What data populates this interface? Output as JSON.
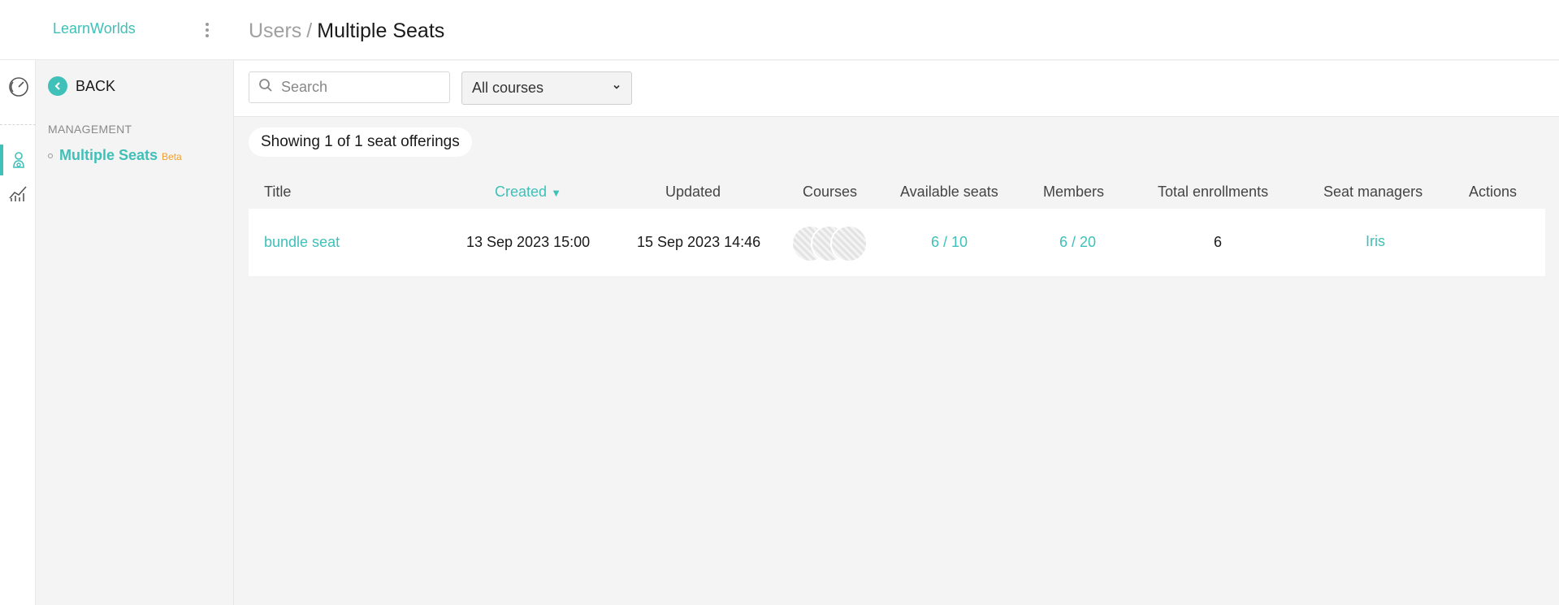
{
  "brand": {
    "name": "LearnWorlds"
  },
  "sidebar": {
    "back_label": "BACK",
    "section_heading": "MANAGEMENT",
    "items": [
      {
        "label": "Multiple Seats",
        "badge": "Beta",
        "active": true
      }
    ]
  },
  "rail": {
    "icons": [
      "gauge-icon",
      "user-seat-icon",
      "analytics-chart-icon"
    ],
    "active_color": "#3fc0b8"
  },
  "header": {
    "breadcrumb_parent": "Users",
    "breadcrumb_separator": "/",
    "breadcrumb_current": "Multiple Seats"
  },
  "toolbar": {
    "search_placeholder": "Search",
    "course_filter_value": "All courses"
  },
  "main": {
    "count_text": "Showing 1 of 1 seat offerings",
    "columns": [
      "Title",
      "Created",
      "Updated",
      "Courses",
      "Available seats",
      "Members",
      "Total enrollments",
      "Seat managers",
      "Actions"
    ],
    "sorted_column": "Created",
    "sort_indicator": "▼",
    "rows": [
      {
        "title": "bundle seat",
        "created": "13 Sep 2023 15:00",
        "updated": "15 Sep 2023 14:46",
        "course_count_thumbs": 3,
        "available_seats": "6 / 10",
        "members": "6 / 20",
        "total_enrollments": "6",
        "seat_managers": "Iris",
        "actions": ""
      }
    ]
  },
  "colors": {
    "accent": "#3fc0b8",
    "badge": "#f0a030",
    "background": "#f4f4f4"
  }
}
